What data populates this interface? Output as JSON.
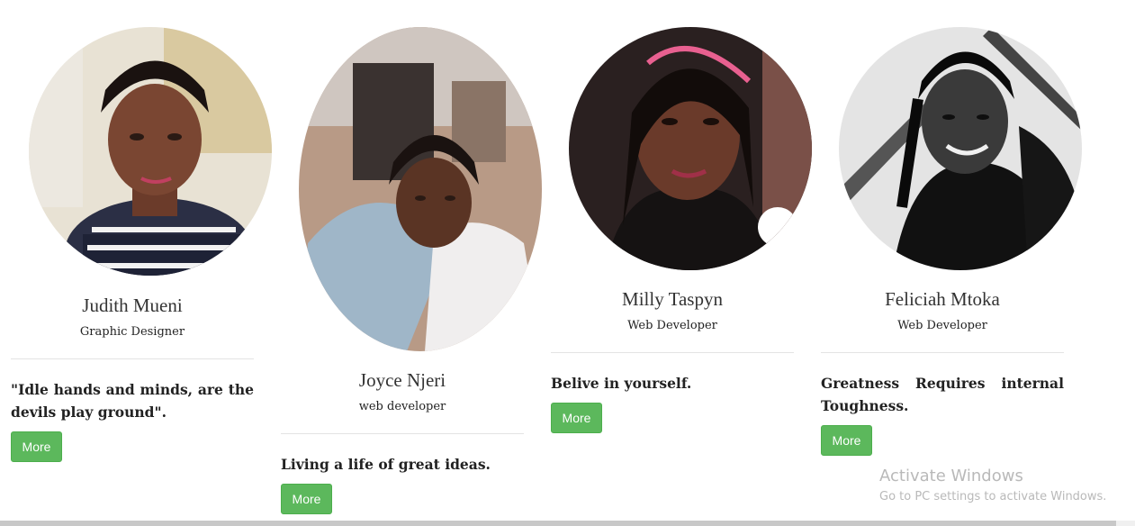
{
  "team": [
    {
      "name": "Judith Mueni",
      "role": "Graphic Designer",
      "quote": "\"Idle hands and minds, are the devils play ground\".",
      "button_label": "More"
    },
    {
      "name": "Joyce Njeri",
      "role": "web developer",
      "quote": "Living a life of great ideas.",
      "button_label": "More"
    },
    {
      "name": "Milly Taspyn",
      "role": "Web Developer",
      "quote": "Belive in yourself.",
      "button_label": "More"
    },
    {
      "name": "Feliciah Mtoka",
      "role": "Web Developer",
      "quote": "Greatness Requires internal Toughness.",
      "button_label": "More"
    }
  ],
  "watermark": {
    "title": "Activate Windows",
    "subtitle": "Go to PC settings to activate Windows."
  },
  "colors": {
    "button": "#5cb85c",
    "divider": "#e3e3e3",
    "watermark": "#b9b9b9"
  }
}
